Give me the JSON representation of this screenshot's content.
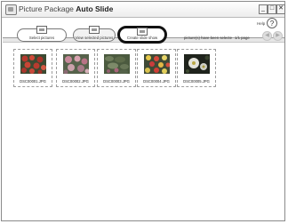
{
  "window": {
    "title_prefix": "Picture Package",
    "title_bold": "Auto Slide",
    "controls": {
      "minimize": "_",
      "maximize": "□",
      "close": "✕"
    }
  },
  "help": {
    "label": "Help",
    "icon": "?"
  },
  "steps": [
    {
      "label": "Select pictures",
      "icon": "picture-select-icon"
    },
    {
      "label": "View selected pictures",
      "icon": "selected-pictures-icon",
      "active": true
    },
    {
      "label": "Create slide show",
      "icon": "slide-show-icon",
      "highlighted": true
    }
  ],
  "status_text": "picture(s) have been selecte",
  "page_label": "1/1 page",
  "pager": {
    "prev": "◀",
    "next": "▶"
  },
  "thumbnails": [
    {
      "file": "DSC00001.JPG",
      "scene": "red-flowers"
    },
    {
      "file": "DSC00002.JPG",
      "scene": "pink-flowers"
    },
    {
      "file": "DSC00003.JPG",
      "scene": "green-foliage"
    },
    {
      "file": "DSC00004.JPG",
      "scene": "flower-bed"
    },
    {
      "file": "DSC00005.JPG",
      "scene": "dark-flowers"
    }
  ]
}
